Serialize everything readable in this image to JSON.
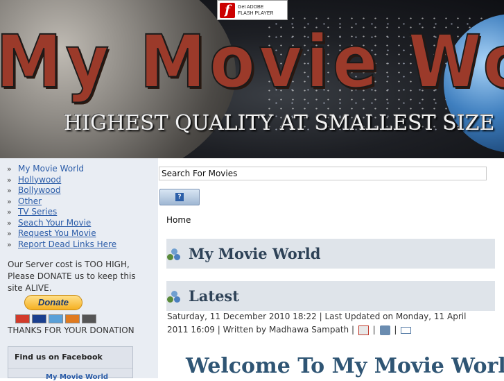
{
  "banner": {
    "title": "My Movie World",
    "tagline": "HIGHEST QUALITY AT SMALLEST SIZE",
    "flash_badge": {
      "line1": "Get ADOBE",
      "line2": "FLASH PLAYER"
    }
  },
  "sidebar": {
    "menu": [
      {
        "label": "My Movie World",
        "current": true
      },
      {
        "label": "Hollywood"
      },
      {
        "label": "Bollywood"
      },
      {
        "label": "Other"
      },
      {
        "label": "TV Series"
      },
      {
        "label": "Seach Your Movie"
      },
      {
        "label": "Request You Movie"
      },
      {
        "label": "Report Dead Links Here"
      }
    ],
    "donate_text": "Our Server cost is TOO HIGH, Please DONATE us to keep this site ALIVE.",
    "donate_button": "Donate",
    "thanks": "THANKS FOR YOUR DONATION",
    "facebook": {
      "title": "Find us on Facebook",
      "page_name": "My Movie World"
    }
  },
  "main": {
    "search": {
      "value": "Search For Movies"
    },
    "breadcrumb": "Home",
    "section1": "My Movie World",
    "section2": "Latest",
    "meta": "Saturday, 11 December 2010 18:22 | Last Updated on Monday, 11 April 2011 16:09 | Written by Madhawa Sampath |",
    "welcome": "Welcome To My Movie World"
  }
}
